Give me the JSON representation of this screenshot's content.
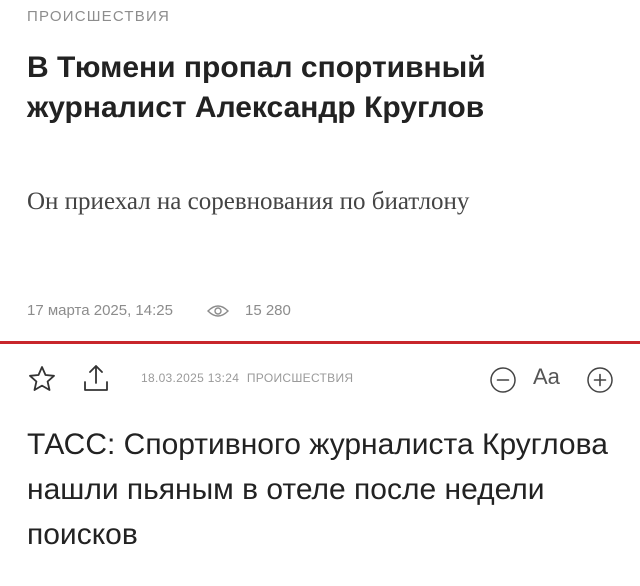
{
  "first_article": {
    "category": "ПРОИСШЕСТВИЯ",
    "title": "В Тюмени пропал спортивный журналист Александр Круглов",
    "lead": "Он приехал на соревнования по биатлону",
    "datetime": "17 марта 2025, 14:25",
    "views": "15 280",
    "icons": {
      "views": "eye-icon"
    }
  },
  "divider_color": "#c8262b",
  "second_article": {
    "date": "18.03.2025 13:24",
    "category": "ПРОИСШЕСТВИЯ",
    "font_size_label": "Aa",
    "title": "ТАСС: Спортивного журналиста Круглова нашли пьяным в отеле после недели поисков",
    "icons": {
      "favorite": "star-icon",
      "share": "share-icon",
      "decrease_font": "minus-circle-icon",
      "increase_font": "plus-circle-icon"
    }
  }
}
